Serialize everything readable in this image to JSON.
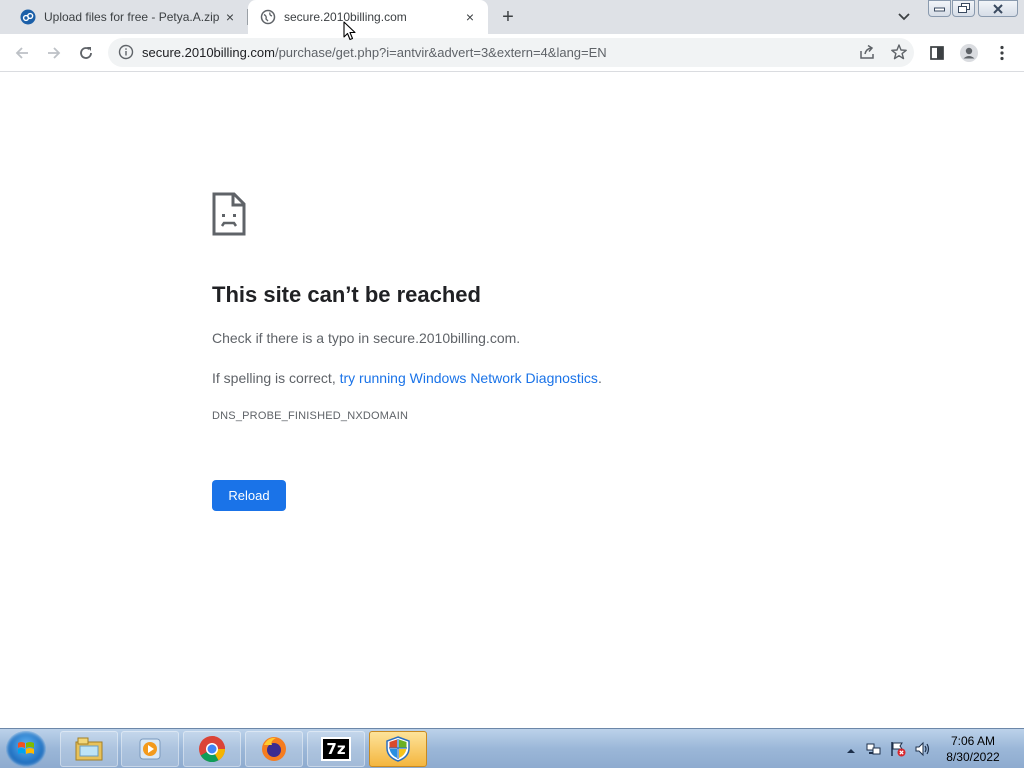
{
  "tabs": [
    {
      "title": "Upload files for free - Petya.A.zip",
      "close": "×",
      "active": false
    },
    {
      "title": "secure.2010billing.com",
      "close": "×",
      "active": true
    }
  ],
  "new_tab_label": "+",
  "address_bar": {
    "host": "secure.2010billing.com",
    "path": "/purchase/get.php?i=antvir&advert=3&extern=4&lang=EN"
  },
  "error_page": {
    "title": "This site can’t be reached",
    "line1": "Check if there is a typo in secure.2010billing.com.",
    "line2_prefix": "If spelling is correct, ",
    "line2_link": "try running Windows Network Diagnostics",
    "line2_suffix": ".",
    "error_code": "DNS_PROBE_FINISHED_NXDOMAIN",
    "reload_label": "Reload"
  },
  "taskbar": {
    "apps": [
      "explorer-icon",
      "media-player-icon",
      "chrome-icon",
      "firefox-icon",
      "7zip-icon",
      "security-shield-icon"
    ],
    "sevenzip_label": "7z",
    "time": "7:06 AM",
    "date": "8/30/2022"
  },
  "colors": {
    "accent": "#1a73e8",
    "tabstrip": "#dee1e6",
    "omnibox": "#f1f3f4"
  }
}
